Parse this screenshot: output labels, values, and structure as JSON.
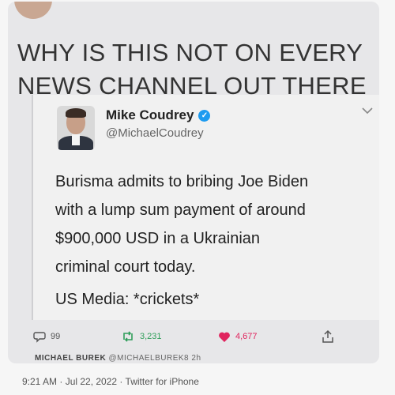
{
  "headline": "WHY IS THIS NOT ON EVERY\nNEWS CHANNEL OUT THERE",
  "author": {
    "name": "Mike Coudrey",
    "handle": "@MichaelCoudrey",
    "verified": true,
    "avatar_icon": "profile-photo"
  },
  "tweet": {
    "lines": [
      "Burisma admits to bribing Joe Biden",
      "with a lump sum payment of around",
      "$900,000 USD in a Ukrainian",
      "criminal court today."
    ],
    "footer": "US Media: *crickets*"
  },
  "actions": {
    "comments": "99",
    "retweets": "3,231",
    "likes": "4,677",
    "like_color": "#e0245e",
    "retweet_color": "#2f9e5a"
  },
  "next_tweet": {
    "name": "MICHAEL BUREK",
    "handle": "@MICHAELBUREK8",
    "time": "2h"
  },
  "meta": {
    "timestamp": "9:21 AM · Jul 22, 2022 · Twitter for iPhone"
  }
}
